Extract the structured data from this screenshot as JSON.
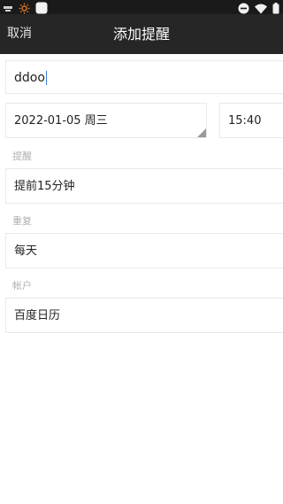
{
  "status_bar": {
    "left_icons": [
      "usb-icon",
      "brightness-icon",
      "app-icon"
    ],
    "right_icons": [
      "minus-circle-icon",
      "wifi-icon",
      "battery-icon"
    ]
  },
  "header": {
    "cancel_label": "取消",
    "title": "添加提醒"
  },
  "form": {
    "title_value": "ddoo",
    "date_value": "2022-01-05 周三",
    "time_value": "15:40",
    "reminder_label": "提醒",
    "reminder_value": "提前15分钟",
    "repeat_label": "重复",
    "repeat_value": "每天",
    "account_label": "帐户",
    "account_value": "百度日历"
  },
  "colors": {
    "status_bar": "#1a1a1a",
    "app_bar": "#262626",
    "cursor": "#3a7bd5"
  }
}
